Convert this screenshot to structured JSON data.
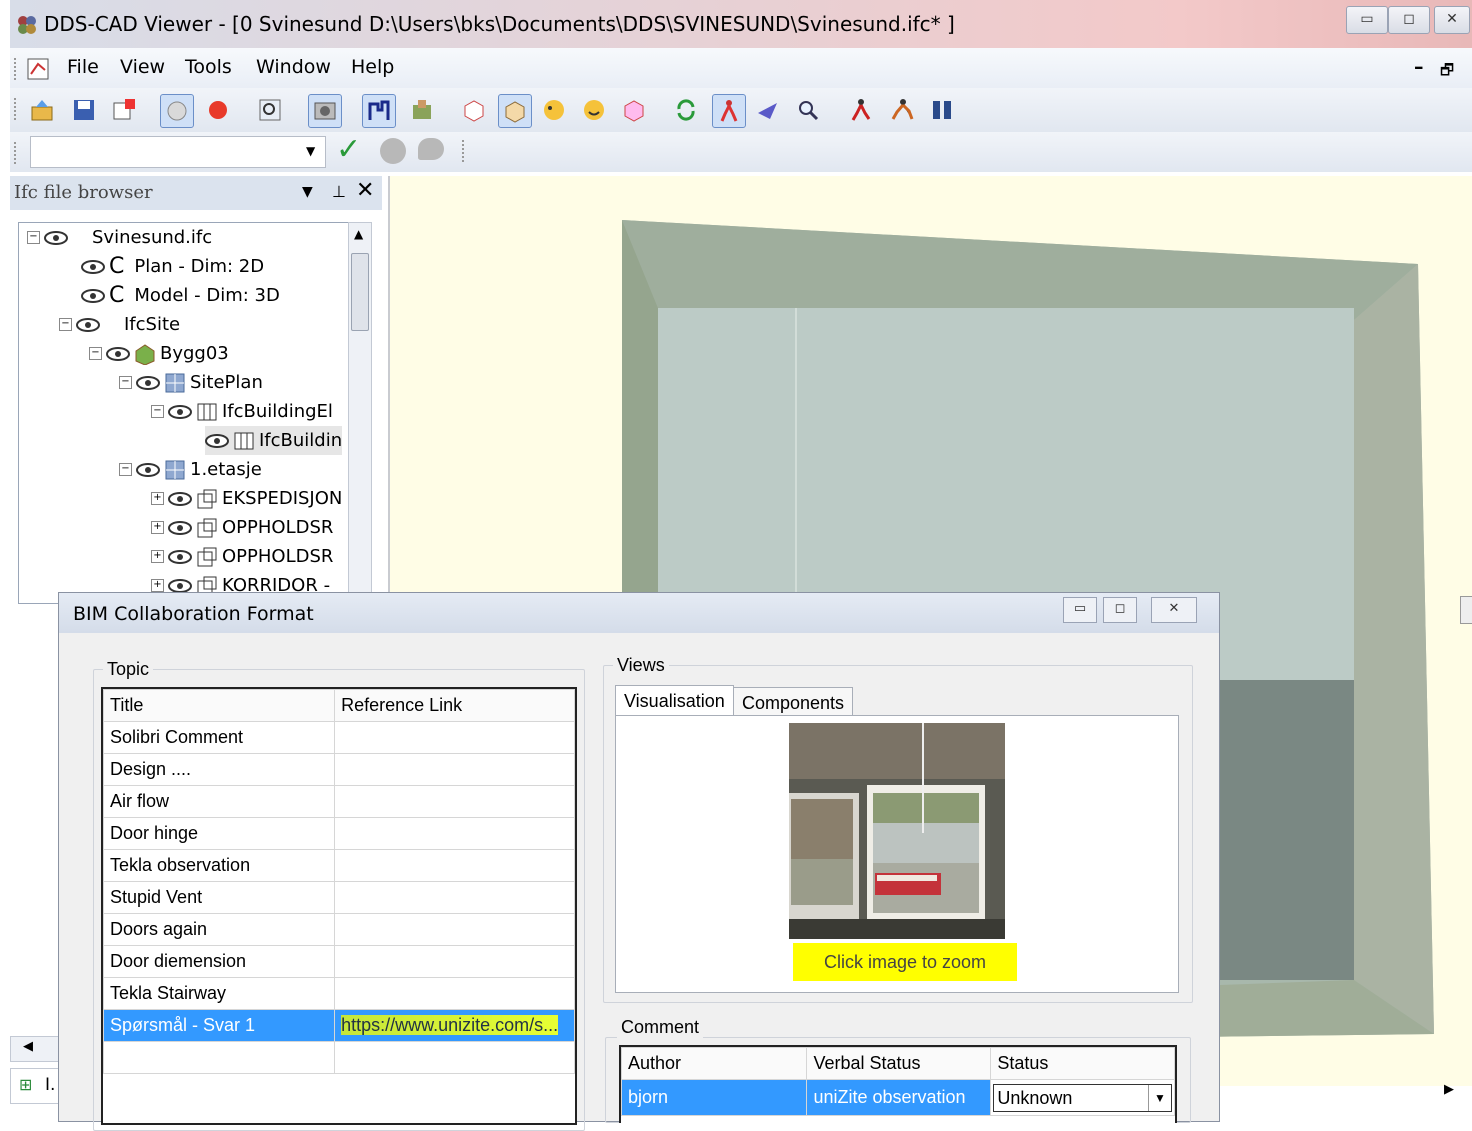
{
  "window": {
    "title": "DDS-CAD Viewer - [0  Svinesund  D:\\Users\\bks\\Documents\\DDS\\SVINESUND\\Svinesund.ifc* ]",
    "controls": {
      "minimize": "▭",
      "maximize": "◻",
      "close": "✕"
    }
  },
  "menu": {
    "items": [
      "File",
      "View",
      "Tools",
      "Window",
      "Help"
    ],
    "mdi_min": "–",
    "mdi_restore": "🗗"
  },
  "toolbar": {
    "icons": [
      "open-icon",
      "save-icon",
      "export-icon",
      "circle-icon",
      "record-icon",
      "zoom-window-icon",
      "camera-icon",
      "walk-icon",
      "model-icon",
      "section-box-icon",
      "box-icon",
      "face-left-icon",
      "face-icon",
      "section-icon",
      "refresh-icon",
      "person-icon",
      "fly-icon",
      "search-icon",
      "person-walk-icon",
      "person-run-icon",
      "binoculars-icon"
    ]
  },
  "toolbar2": {
    "combo_value": "",
    "confirm": "✓"
  },
  "browser": {
    "title": "Ifc file browser",
    "tree": [
      {
        "label": "Svinesund.ifc",
        "indent": 0,
        "expander": "−"
      },
      {
        "label": "Plan - Dim: 2D",
        "indent": 1,
        "prefix": "C"
      },
      {
        "label": "Model - Dim: 3D",
        "indent": 1,
        "prefix": "C"
      },
      {
        "label": "IfcSite",
        "indent": 1,
        "expander": "−"
      },
      {
        "label": "Bygg03",
        "indent": 2,
        "expander": "−"
      },
      {
        "label": "SitePlan",
        "indent": 3,
        "expander": "−"
      },
      {
        "label": "IfcBuildingEl",
        "indent": 4,
        "expander": "−"
      },
      {
        "label": "IfcBuildin",
        "indent": 5
      },
      {
        "label": "1.etasje",
        "indent": 3,
        "expander": "−"
      },
      {
        "label": "EKSPEDISJON",
        "indent": 4,
        "expander": "+"
      },
      {
        "label": "OPPHOLDSR",
        "indent": 4,
        "expander": "+"
      },
      {
        "label": "OPPHOLDSR",
        "indent": 4,
        "expander": "+"
      },
      {
        "label": "KORRIDOR -",
        "indent": 4,
        "expander": "+"
      }
    ],
    "bottom_tab": "I."
  },
  "bcf": {
    "title": "BIM Collaboration Format",
    "topic_label": "Topic",
    "columns": [
      "Title",
      "Reference Link"
    ],
    "topics": [
      {
        "title": "Solibri Comment",
        "link": ""
      },
      {
        "title": "Design ....",
        "link": ""
      },
      {
        "title": "Air flow",
        "link": ""
      },
      {
        "title": "Door hinge",
        "link": ""
      },
      {
        "title": "Tekla observation",
        "link": ""
      },
      {
        "title": "Stupid Vent",
        "link": ""
      },
      {
        "title": "Doors again",
        "link": ""
      },
      {
        "title": "Door diemension",
        "link": ""
      },
      {
        "title": "Tekla Stairway",
        "link": ""
      },
      {
        "title": "Spørsmål - Svar 1",
        "link": "https://www.unizite.com/s..."
      }
    ],
    "selected_index": 9,
    "views_label": "Views",
    "tabs": [
      "Visualisation",
      "Components"
    ],
    "zoom_hint": "Click image to zoom",
    "comment_label": "Comment",
    "comment_columns": [
      "Author",
      "Verbal Status",
      "Status"
    ],
    "comments": [
      {
        "author": "bjorn",
        "verbal_status": "uniZite observation",
        "status": "Unknown"
      }
    ]
  },
  "colors": {
    "selection": "#3399ff",
    "highlight": "#ffff00",
    "viewport_bg": "#fffde6"
  }
}
